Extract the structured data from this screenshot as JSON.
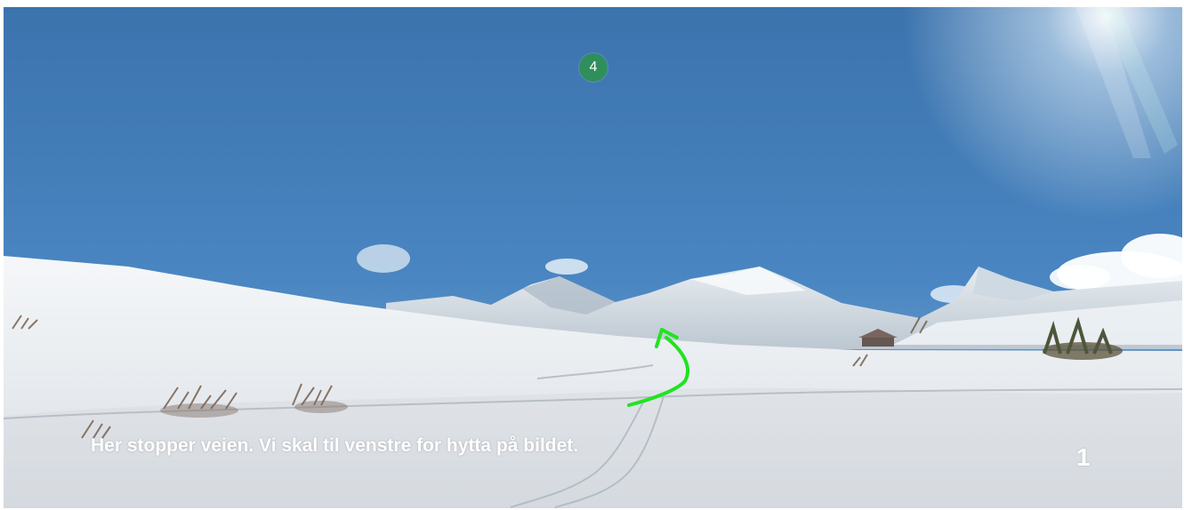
{
  "badge": {
    "number": "4",
    "color": "#2f8f5b"
  },
  "photo": {
    "caption": "Her stopper veien. Vi skal til venstre for hytta på bildet.",
    "image_number": "1",
    "arrow_color": "#21e321",
    "icon": "curved-arrow-icon"
  }
}
